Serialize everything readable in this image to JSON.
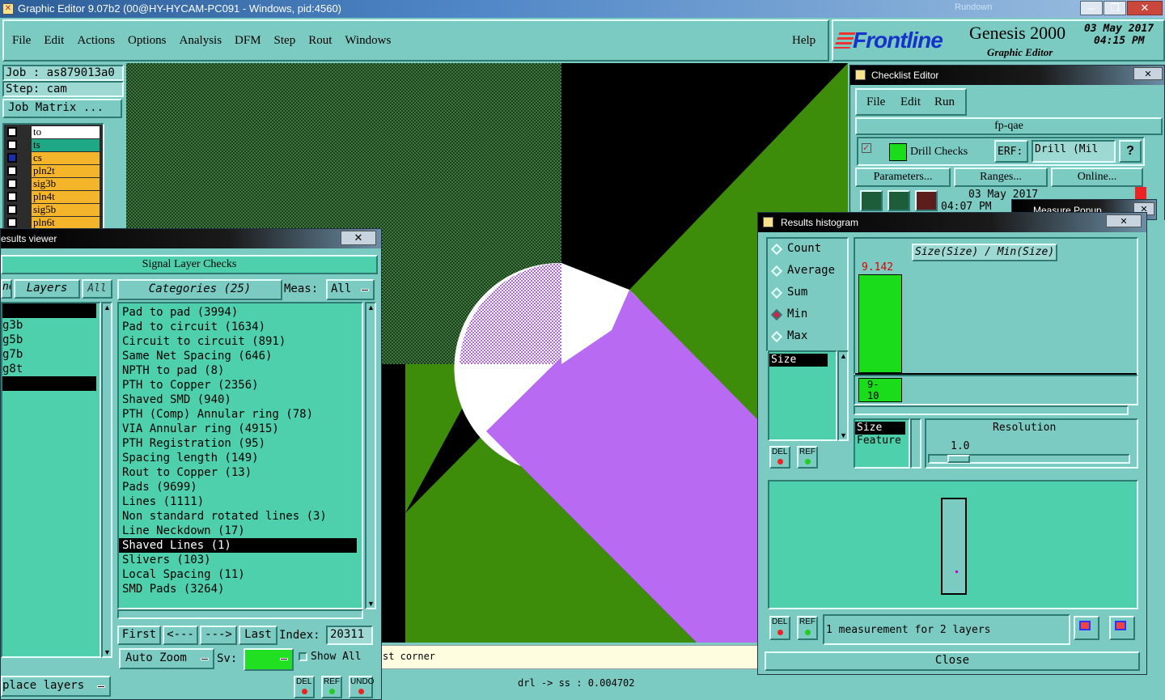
{
  "window": {
    "title": "Graphic Editor 9.07b2 (00@HY-HYCAM-PC091 - Windows, pid:4560)",
    "ghost": "Rundown"
  },
  "menu": {
    "items": [
      "File",
      "Edit",
      "Actions",
      "Options",
      "Analysis",
      "DFM",
      "Step",
      "Rout",
      "Windows"
    ],
    "help": "Help"
  },
  "brand": {
    "logo": "Frontline",
    "product": "Genesis 2000",
    "subtitle": "Graphic Editor",
    "date": "03 May 2017",
    "time": "04:15 PM"
  },
  "job": {
    "job": "Job : as879013a0",
    "step": "Step: cam",
    "matrix": "Job Matrix ..."
  },
  "layers": [
    {
      "name": "to",
      "color": "#ffffff"
    },
    {
      "name": "ts",
      "color": "#1fa886"
    },
    {
      "name": "cs",
      "color": "#f5b52a"
    },
    {
      "name": "pln2t",
      "color": "#f5b52a"
    },
    {
      "name": "sig3b",
      "color": "#f5b52a"
    },
    {
      "name": "pln4t",
      "color": "#f5b52a"
    },
    {
      "name": "sig5b",
      "color": "#f5b52a"
    },
    {
      "name": "pln6t",
      "color": "#f5b52a"
    }
  ],
  "results_viewer": {
    "title": "esults viewer",
    "header": "Signal Layer Checks",
    "tab_left": "ne",
    "layers_label": "Layers",
    "all_label": "All",
    "left_items": [
      "",
      "g3b",
      "g5b",
      "g7b",
      "g8t",
      ""
    ],
    "categories_label": "Categories (25)",
    "meas_label": "Meas:",
    "meas_value": "All",
    "categories": [
      "Pad to pad (3994)",
      "Pad to circuit (1634)",
      "Circuit to circuit (891)",
      "Same Net Spacing (646)",
      "NPTH to pad (8)",
      "PTH to Copper (2356)",
      "Shaved SMD (940)",
      "PTH (Comp) Annular ring (78)",
      "VIA Annular ring (4915)",
      "PTH Registration (95)",
      "Spacing length (149)",
      "Rout to Copper (13)",
      "Pads (9699)",
      "Lines (1111)",
      "Non standard rotated lines (3)",
      "Line Neckdown (17)",
      "Shaved Lines (1)",
      "Slivers (103)",
      "Local Spacing (11)",
      "SMD Pads (3264)"
    ],
    "selected_index": 16,
    "first": "First",
    "prev": "<---",
    "next": "--->",
    "last": "Last",
    "index_label": "Index:",
    "index_value": "20311",
    "auto_zoom": "Auto Zoom",
    "sv_label": "Sv:",
    "show_all": "Show All",
    "replace": "place layers",
    "del": "DEL",
    "ref": "REF",
    "undo": "UNDO"
  },
  "status": {
    "hint": "st corner",
    "measure": "drl -> ss : 0.004702"
  },
  "checklist": {
    "title": "Checklist Editor",
    "menu": [
      "File",
      "Edit",
      "Run"
    ],
    "name": "fp-qae",
    "check": "Drill Checks",
    "erf_label": "ERF:",
    "erf_value": "Drill (Mil",
    "help": "?",
    "params": "Parameters...",
    "ranges": "Ranges...",
    "online": "Online...",
    "date": "03 May 2017",
    "time": "04:07 PM"
  },
  "measure_popup": {
    "title": "Measure Popup"
  },
  "histogram": {
    "title": "Results histogram",
    "modes": [
      "Count",
      "Average",
      "Sum",
      "Min",
      "Max"
    ],
    "selected_mode": "Min",
    "list_item": "Size",
    "chart_title": "Size(Size) / Min(Size)",
    "bar_value": "9.142",
    "bin_label": "9-\n10",
    "size_label": "Size",
    "feature_label": "Feature",
    "resolution_label": "Resolution",
    "resolution_value": "1.0",
    "summary": "1 measurement for 2 layers",
    "del": "DEL",
    "ref": "REF",
    "close": "Close"
  },
  "colors": {
    "teal": "#7bcbc3",
    "green_panel": "#4fd0ac",
    "copper": "#3d8c0a",
    "purple": "#b86bf2",
    "bar": "#1bdc1b"
  }
}
